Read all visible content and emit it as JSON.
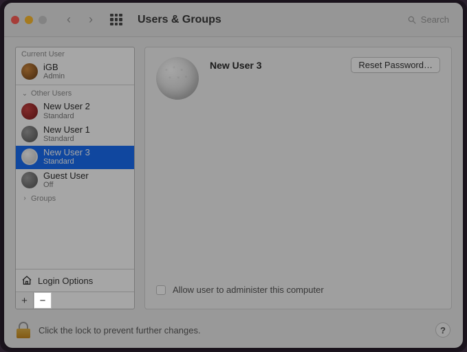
{
  "titlebar": {
    "title": "Users & Groups",
    "search_placeholder": "Search"
  },
  "sidebar": {
    "current_user_header": "Current User",
    "other_users_header": "Other Users",
    "groups_header": "Groups",
    "current_user": {
      "name": "iGB",
      "role": "Admin",
      "avatar": "orange"
    },
    "users": [
      {
        "name": "New User 2",
        "role": "Standard",
        "avatar": "red",
        "selected": false
      },
      {
        "name": "New User 1",
        "role": "Standard",
        "avatar": "grey",
        "selected": false
      },
      {
        "name": "New User 3",
        "role": "Standard",
        "avatar": "golf",
        "selected": true
      },
      {
        "name": "Guest User",
        "role": "Off",
        "avatar": "grey",
        "selected": false
      }
    ],
    "login_options_label": "Login Options",
    "add_glyph": "+",
    "remove_glyph": "−"
  },
  "detail": {
    "user_name": "New User 3",
    "reset_password_label": "Reset Password…",
    "admin_checkbox_label": "Allow user to administer this computer",
    "admin_checked": false
  },
  "footer": {
    "lock_text": "Click the lock to prevent further changes.",
    "help_glyph": "?"
  }
}
